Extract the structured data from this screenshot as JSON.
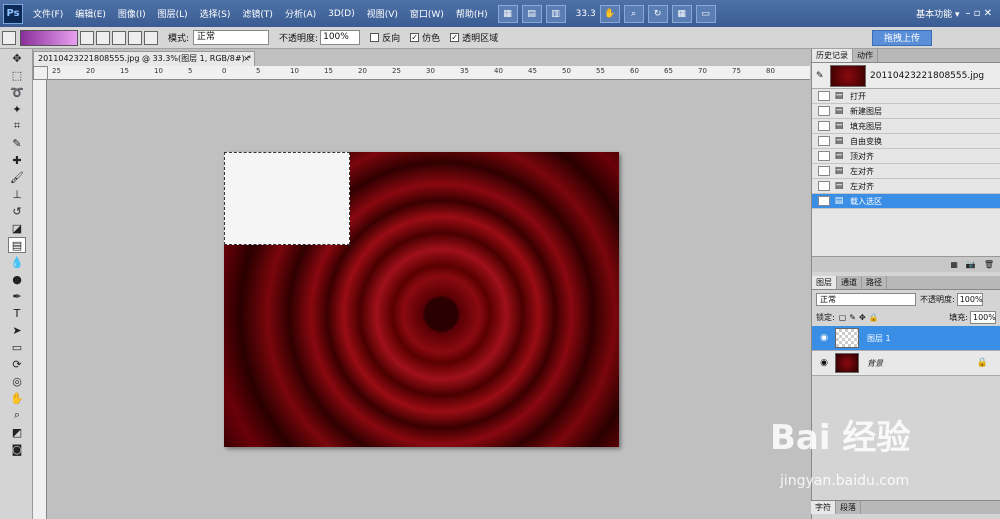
{
  "menubar": {
    "logo": "Ps",
    "items": [
      "文件(F)",
      "编辑(E)",
      "图像(I)",
      "图层(L)",
      "选择(S)",
      "滤镜(T)",
      "分析(A)",
      "3D(D)",
      "视图(V)",
      "窗口(W)",
      "帮助(H)"
    ],
    "zoom": "33.3",
    "workspace": "基本功能 ▾",
    "window_controls": "–  ▫  ✕"
  },
  "options": {
    "mode_label": "模式:",
    "mode_value": "正常",
    "opacity_label": "不透明度:",
    "opacity_value": "100%",
    "reverse_label": "反向",
    "dither_label": "仿色",
    "transparency_label": "透明区域",
    "upload_label": "拖拽上传"
  },
  "document": {
    "tab_title": "20110423221808555.jpg @ 33.3%(图层 1, RGB/8#) *",
    "close": "×",
    "ruler_ticks": [
      "25",
      "20",
      "15",
      "10",
      "5",
      "0",
      "5",
      "10",
      "15",
      "20",
      "25",
      "30",
      "35",
      "40",
      "45",
      "50",
      "55",
      "60",
      "65",
      "70",
      "75",
      "80"
    ]
  },
  "history": {
    "tabs": [
      "历史记录",
      "动作"
    ],
    "snapshot_name": "20110423221808555.jpg",
    "items": [
      "打开",
      "新建图层",
      "填充图层",
      "自由变换",
      "顶对齐",
      "左对齐",
      "左对齐",
      "载入选区"
    ],
    "active_index": 7
  },
  "layers": {
    "tabs": [
      "图层",
      "通道",
      "路径"
    ],
    "blend_mode": "正常",
    "opacity_label": "不透明度:",
    "opacity_value": "100%",
    "lock_label": "锁定:",
    "fill_label": "填充:",
    "fill_value": "100%",
    "items": [
      "图层 1",
      "背景"
    ]
  },
  "bottom_tabs": [
    "字符",
    "段落"
  ],
  "watermark": {
    "main": "Bai 经验",
    "sub": "jingyan.baidu.com"
  },
  "colors": {
    "menubar": "#3f6299",
    "active_row": "#3a8ee6",
    "canvas_red": "#8a0a10"
  }
}
